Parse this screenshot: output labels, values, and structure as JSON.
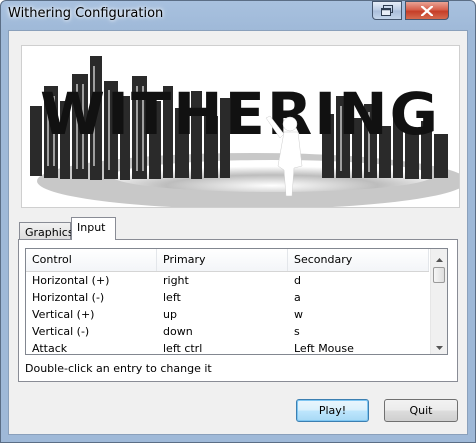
{
  "window": {
    "title": "Withering Configuration",
    "controls": {
      "restore_icon": "restore-icon",
      "close_icon": "close-icon"
    }
  },
  "banner": {
    "logo_text": "WITHERING"
  },
  "tabs": [
    {
      "label": "Graphics",
      "selected": false
    },
    {
      "label": "Input",
      "selected": true
    }
  ],
  "controls_list": {
    "columns": [
      "Control",
      "Primary",
      "Secondary"
    ],
    "rows": [
      {
        "control": "Horizontal (+)",
        "primary": "right",
        "secondary": "d"
      },
      {
        "control": "Horizontal (-)",
        "primary": "left",
        "secondary": "a"
      },
      {
        "control": "Vertical (+)",
        "primary": "up",
        "secondary": "w"
      },
      {
        "control": "Vertical (-)",
        "primary": "down",
        "secondary": "s"
      },
      {
        "control": "Attack",
        "primary": "left ctrl",
        "secondary": "Left Mouse"
      }
    ]
  },
  "hint": "Double-click an entry to change it",
  "buttons": {
    "play": "Play!",
    "quit": "Quit"
  },
  "colors": {
    "title_bar": "#9fb9d8",
    "close_button": "#c63e28",
    "default_button_border": "#3c7fb1"
  }
}
